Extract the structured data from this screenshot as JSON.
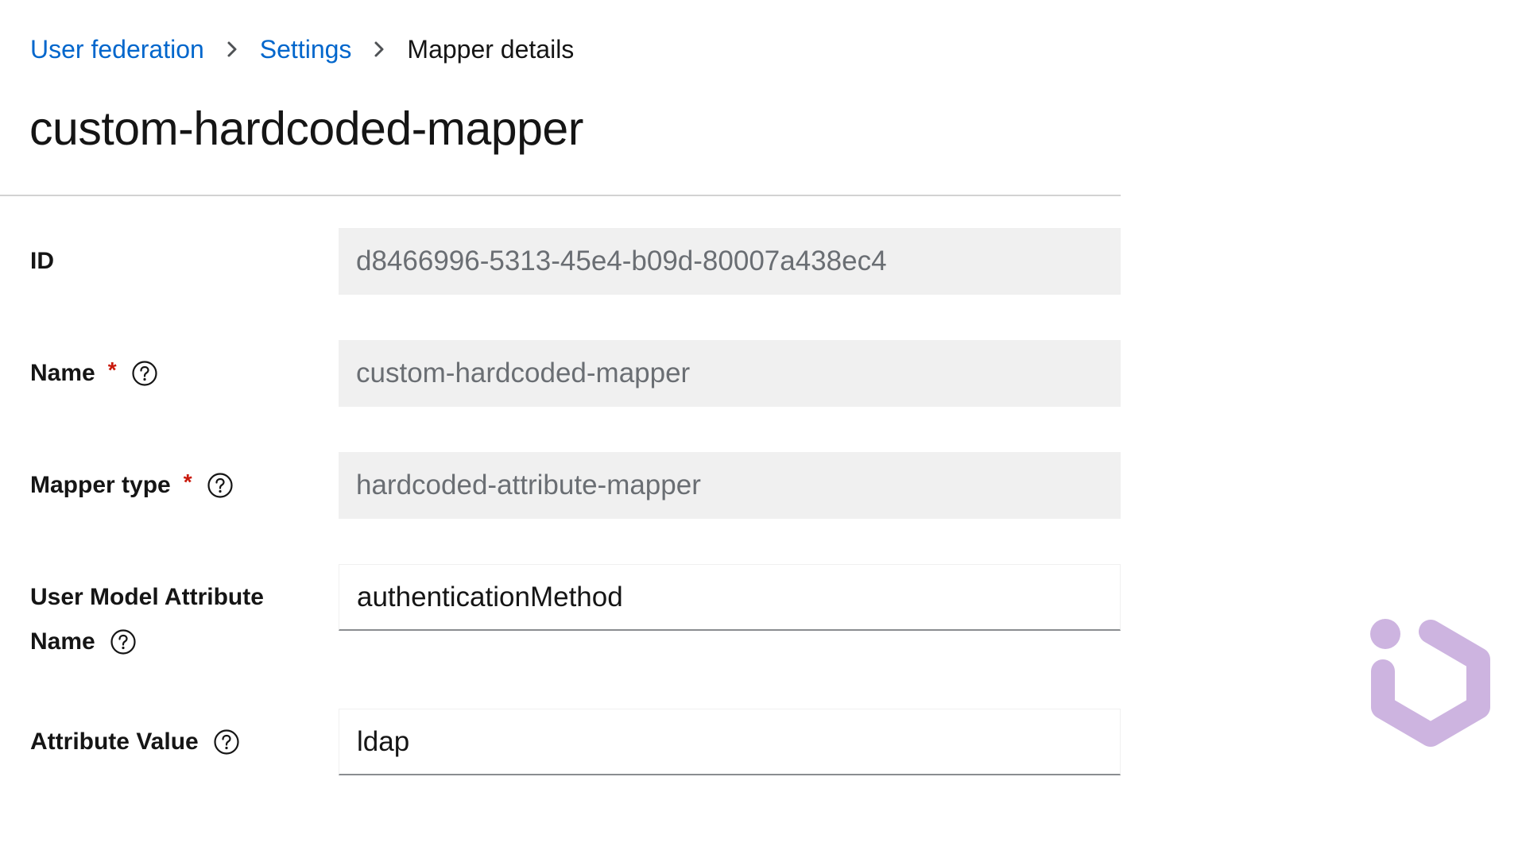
{
  "breadcrumb": {
    "items": [
      {
        "label": "User federation"
      },
      {
        "label": "Settings"
      },
      {
        "label": "Mapper details"
      }
    ]
  },
  "page": {
    "title": "custom-hardcoded-mapper"
  },
  "form": {
    "id": {
      "label": "ID",
      "value": "d8466996-5313-45e4-b09d-80007a438ec4"
    },
    "name": {
      "label": "Name",
      "required": "*",
      "value": "custom-hardcoded-mapper"
    },
    "mapper_type": {
      "label": "Mapper type",
      "required": "*",
      "value": "hardcoded-attribute-mapper"
    },
    "user_model_attribute": {
      "label_line1": "User Model Attribute",
      "label_line2": "Name",
      "value": "authenticationMethod"
    },
    "attribute_value": {
      "label": "Attribute Value",
      "value": "ldap"
    }
  },
  "icons": {
    "breadcrumb_separator": "chevron-right-icon",
    "help": "question-circle-icon",
    "watermark": "hexagon-logo-icon"
  },
  "colors": {
    "link": "#0066cc",
    "required": "#c9190b",
    "readonly_bg": "#f0f0f0",
    "watermark": "#cdb4e0"
  }
}
